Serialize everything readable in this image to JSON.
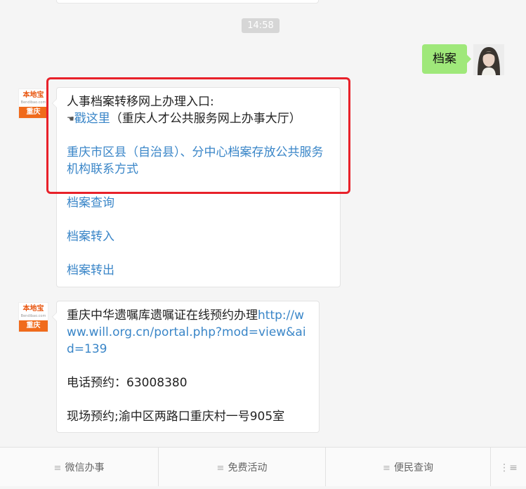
{
  "chat": {
    "timestamp": "14:58",
    "user_message": "档案",
    "bot": {
      "logo_text": "本地宝",
      "logo_site": "Bendibao.com",
      "logo_city": "重庆"
    },
    "message1": {
      "line1": "人事档案转移网上办理入口:",
      "hand_icon": "☚",
      "link1": "戳这里",
      "line2_suffix": "（重庆人才公共服务网上办事大厅）",
      "link2": "重庆市区县（自治县）、分中心档案存放公共服务机构联系方式",
      "link3": "档案查询",
      "link4": "档案转入",
      "link5": "档案转出"
    },
    "message2": {
      "text1": "重庆中华遗嘱库遗嘱证在线预约办理",
      "url": "http://www.will.org.cn/portal.php?mod=view&aid=139",
      "phone": "电话预约：63008380",
      "onsite": "现场预约;渝中区两路口重庆村一号905室"
    }
  },
  "bottom_menu": {
    "items": [
      "微信办事",
      "免费活动",
      "便民查询"
    ],
    "menu_glyph": "≡",
    "keyboard_toggle": "⋮≡"
  },
  "colors": {
    "accent": "#e8212a",
    "link": "#3a86c8",
    "user_bubble": "#9fe87a"
  }
}
